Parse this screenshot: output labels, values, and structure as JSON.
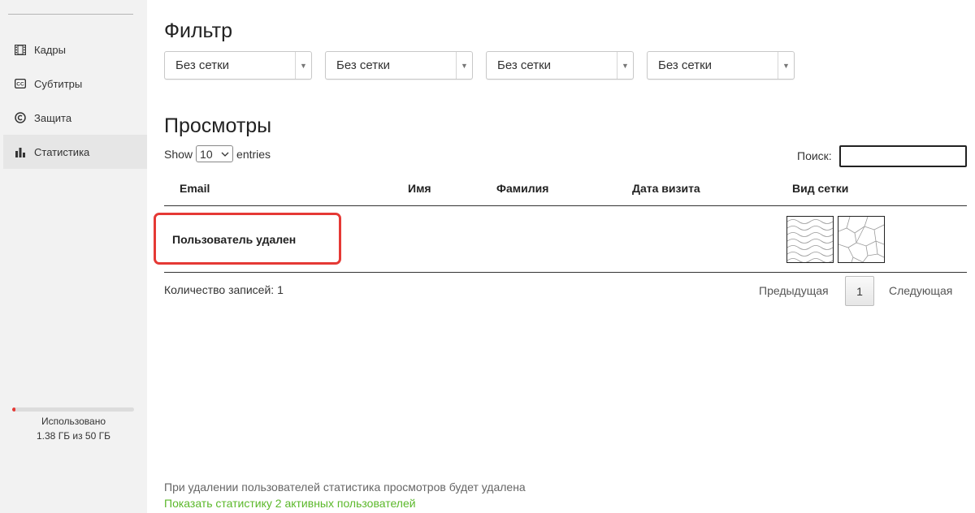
{
  "sidebar": {
    "items": [
      {
        "label": "Кадры",
        "icon": "film-icon"
      },
      {
        "label": "Субтитры",
        "icon": "cc-icon"
      },
      {
        "label": "Защита",
        "icon": "copyright-icon"
      },
      {
        "label": "Статистика",
        "icon": "bar-chart-icon"
      }
    ],
    "active_index": 3,
    "storage": {
      "used_label": "Использовано",
      "amount_label": "1.38 ГБ из 50 ГБ",
      "used_fraction": 0.028,
      "fill_color": "#e53935"
    }
  },
  "filter": {
    "title": "Фильтр",
    "selects": [
      {
        "value": "Без сетки"
      },
      {
        "value": "Без сетки"
      },
      {
        "value": "Без сетки"
      },
      {
        "value": "Без сетки"
      }
    ]
  },
  "views": {
    "title": "Просмотры",
    "show_label": "Show",
    "entries_value": "10",
    "entries_label": "entries",
    "search_label": "Поиск:",
    "search_value": "",
    "columns": [
      "Email",
      "Имя",
      "Фамилия",
      "Дата визита",
      "Вид сетки"
    ],
    "rows": [
      {
        "email": "Пользователь удален",
        "first_name": "",
        "last_name": "",
        "visit_date": "",
        "grid_types": [
          "wave-grid-icon",
          "voronoi-grid-icon"
        ]
      }
    ],
    "highlight_color": "#e53935",
    "count_label": "Количество записей: 1",
    "pager": {
      "prev": "Предыдущая",
      "current": "1",
      "next": "Следующая"
    }
  },
  "footer": {
    "note": "При удалении пользователей статистика просмотров будет удалена",
    "link": "Показать статистику 2 активных пользователей",
    "link_color": "#5bb82a"
  }
}
